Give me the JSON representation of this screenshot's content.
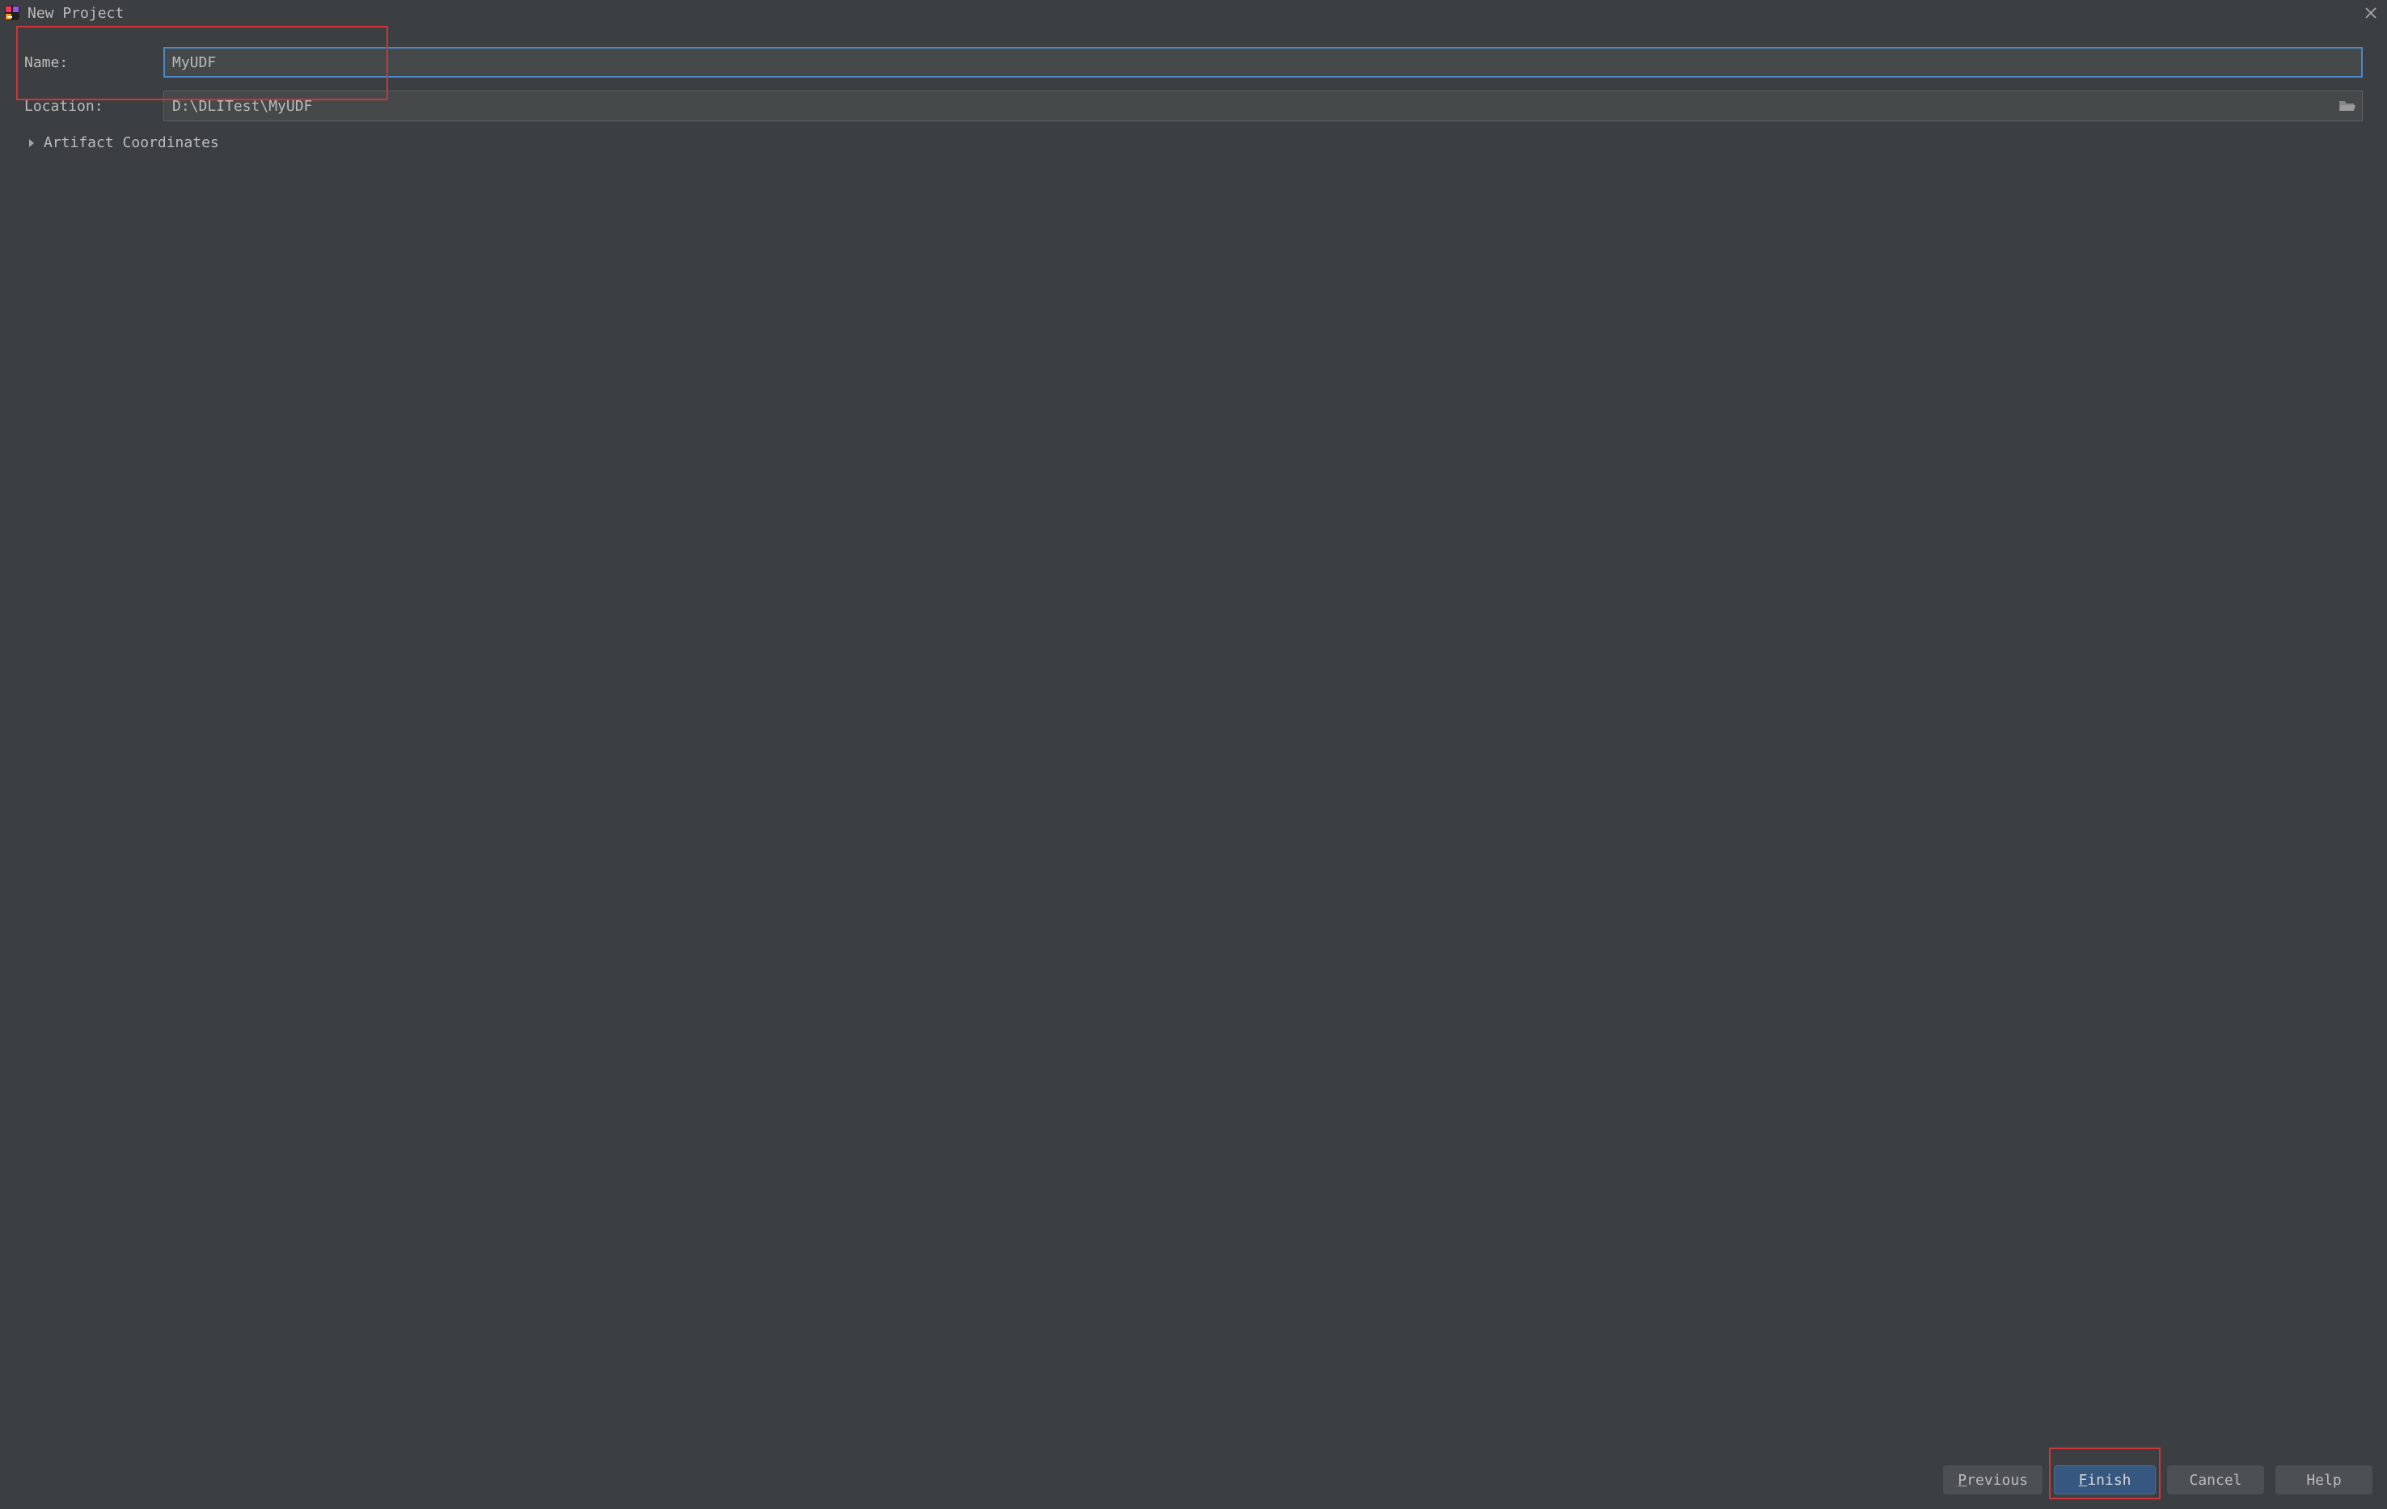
{
  "window": {
    "title": "New Project"
  },
  "form": {
    "name_label": "Name:",
    "name_value": "MyUDF",
    "location_label": "Location:",
    "location_value": "D:\\DLITest\\MyUDF",
    "artifact_label": "Artifact Coordinates"
  },
  "buttons": {
    "previous_mnemonic": "P",
    "previous_rest": "revious",
    "finish_mnemonic": "F",
    "finish_rest": "inish",
    "cancel": "Cancel",
    "help": "Help"
  }
}
